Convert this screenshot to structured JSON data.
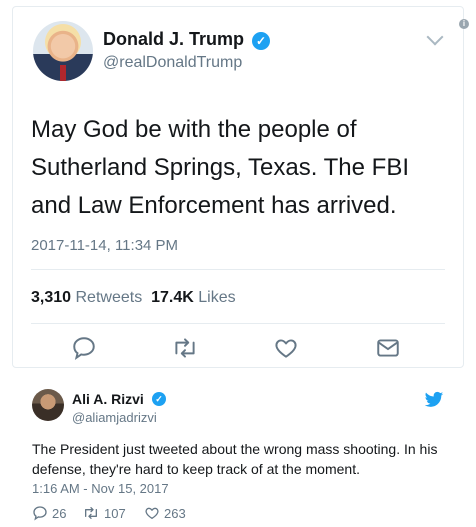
{
  "tweet": {
    "name": "Donald J. Trump",
    "handle": "@realDonaldTrump",
    "text": "May God be with the people of Sutherland Springs, Texas. The FBI and Law Enforcement has arrived.",
    "timestamp": "2017-11-14, 11:34 PM",
    "retweets_count": "3,310",
    "retweets_label": "Retweets",
    "likes_count": "17.4K",
    "likes_label": "Likes",
    "icons": [
      "reply-icon",
      "retweet-icon",
      "like-icon",
      "direct-message-icon",
      "chevron-down-icon",
      "info-icon",
      "verified-icon"
    ]
  },
  "reply": {
    "name": "Ali A. Rizvi",
    "handle": "@aliamjadrizvi",
    "text": "The President just tweeted about the wrong mass shooting. In his defense, they're hard to keep track of at the moment.",
    "timestamp": "1:16 AM - Nov 15, 2017",
    "reply_count": "26",
    "retweet_count": "107",
    "like_count": "263",
    "icons": [
      "twitter-bird-icon",
      "reply-icon",
      "retweet-icon",
      "like-icon"
    ]
  },
  "colors": {
    "accent": "#1da1f2",
    "text": "#14171a",
    "muted": "#657786",
    "border": "#e6ecf0"
  }
}
